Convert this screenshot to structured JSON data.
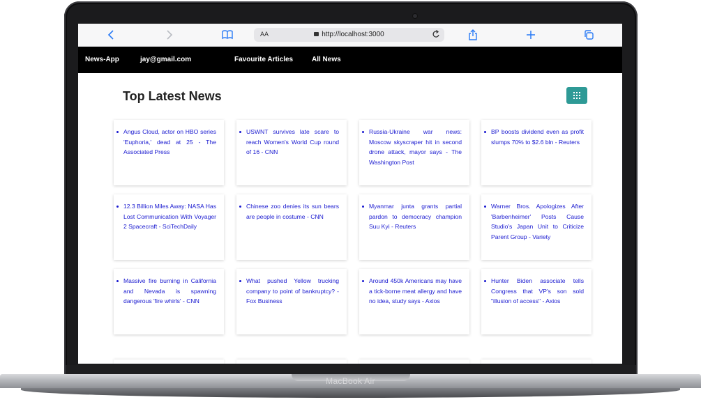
{
  "device": {
    "brand": "MacBook Air"
  },
  "browser": {
    "text_size_label": "AA",
    "url": "http://localhost:3000",
    "icons": {
      "back": "chevron-left-icon",
      "forward": "chevron-right-icon",
      "reader": "book-icon",
      "reload": "reload-icon",
      "share": "share-icon",
      "new_tab": "plus-icon",
      "tabs": "tabs-icon"
    }
  },
  "navbar": {
    "brand": "News-App",
    "user": "jay@gmail.com",
    "links": [
      "Favourite Articles",
      "All News"
    ]
  },
  "main": {
    "title": "Top Latest News",
    "view_toggle_icon": "grid-icon",
    "accent_color": "#2e9a96",
    "link_color": "#1a1ad0",
    "articles": [
      "Angus Cloud, actor on HBO series 'Euphoria,' dead at 25 - The Associated Press",
      "USWNT survives late scare to reach Women's World Cup round of 16 - CNN",
      "Russia-Ukraine war news: Moscow skyscraper hit in second drone attack, mayor says - The Washington Post",
      "BP boosts dividend even as profit slumps 70% to $2.6 bln - Reuters",
      "12.3 Billion Miles Away: NASA Has Lost Communication With Voyager 2 Spacecraft - SciTechDaily",
      "Chinese zoo denies its sun bears are people in costume - CNN",
      "Myanmar junta grants partial pardon to democracy champion Suu Kyi - Reuters",
      "Warner Bros. Apologizes After 'Barbenheimer' Posts Cause Studio's Japan Unit to Criticize Parent Group - Variety",
      "Massive fire burning in California and Nevada is spawning dangerous 'fire whirls' - CNN",
      "What pushed Yellow trucking company to point of bankruptcy? - Fox Business",
      "Around 450k Americans may have a tick-borne meat allergy and have no idea, study says - Axios",
      "Hunter Biden associate tells Congress that VP's son sold \"illusion of access\" - Axios"
    ]
  }
}
